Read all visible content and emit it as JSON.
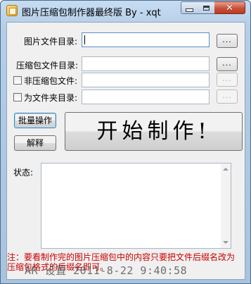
{
  "window": {
    "title": "图片压缩包制作器最终版 By - xqt"
  },
  "form": {
    "image_dir_label": "图片文件目录:",
    "image_dir_value": "",
    "archive_file_label": "压缩包文件目录:",
    "archive_file_value": "",
    "non_archive_label": "非压缩包文件:",
    "non_archive_value": "",
    "folder_dir_label": "为文件夹目录:",
    "folder_dir_value": "",
    "browse_label": "...",
    "batch_button": "批量操作",
    "extract_button": "解释",
    "start_button": "开始制作!",
    "status_label": "状态:",
    "status_text": ""
  },
  "note": "注：要看制作完的图片压缩包中的内容只要把文件后缀名改为压缩包格式的后缀名即可。",
  "stamp": "AR 设置 2011-8-22 9:40:58",
  "colors": {
    "note": "#cc0000",
    "titlebar": "#b5cde6",
    "client_bg": "#f0f0f0"
  }
}
